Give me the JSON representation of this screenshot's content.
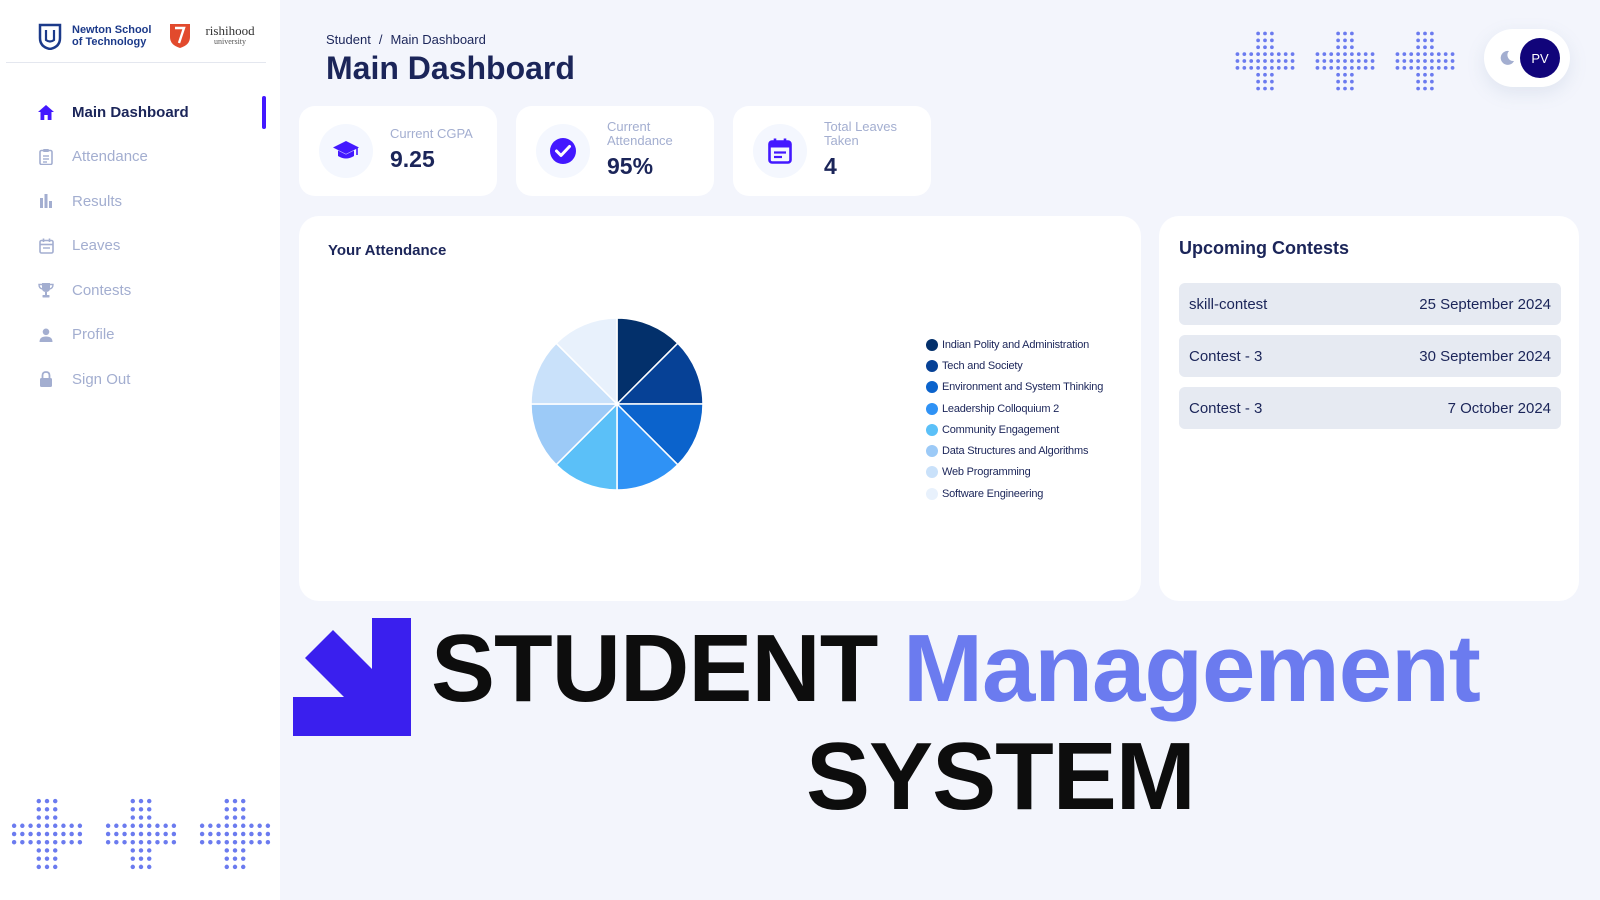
{
  "brand": {
    "school_line1": "Newton School",
    "school_line2": "of Technology",
    "university_name": "rishihood",
    "university_sub": "university"
  },
  "sidebar": {
    "items": [
      {
        "label": "Main Dashboard",
        "icon": "home-icon",
        "active": true
      },
      {
        "label": "Attendance",
        "icon": "clipboard-icon",
        "active": false
      },
      {
        "label": "Results",
        "icon": "bar-chart-icon",
        "active": false
      },
      {
        "label": "Leaves",
        "icon": "calendar-icon",
        "active": false
      },
      {
        "label": "Contests",
        "icon": "trophy-icon",
        "active": false
      },
      {
        "label": "Profile",
        "icon": "person-icon",
        "active": false
      },
      {
        "label": "Sign Out",
        "icon": "lock-icon",
        "active": false
      }
    ]
  },
  "header": {
    "breadcrumb_root": "Student",
    "breadcrumb_separator": "/",
    "breadcrumb_current": "Main Dashboard",
    "title": "Main Dashboard",
    "avatar_initials": "PV"
  },
  "stats": [
    {
      "label": "Current CGPA",
      "value": "9.25",
      "icon": "graduation-cap-icon"
    },
    {
      "label": "Current Attendance",
      "value": "95%",
      "icon": "check-circle-icon"
    },
    {
      "label": "Total Leaves Taken",
      "value": "4",
      "icon": "calendar-icon"
    }
  ],
  "attendance": {
    "title": "Your Attendance",
    "legend": [
      {
        "label": "Indian Polity and Administration",
        "color": "#03306b"
      },
      {
        "label": "Tech and Society",
        "color": "#064196"
      },
      {
        "label": "Environment and System Thinking",
        "color": "#0b63cc"
      },
      {
        "label": "Leadership Colloquium 2",
        "color": "#2f92f5"
      },
      {
        "label": "Community Engagement",
        "color": "#5bc0f8"
      },
      {
        "label": "Data Structures and Algorithms",
        "color": "#9ccaf7"
      },
      {
        "label": "Web Programming",
        "color": "#c9e1fa"
      },
      {
        "label": "Software Engineering",
        "color": "#e8f1fc"
      }
    ]
  },
  "contests": {
    "title": "Upcoming Contests",
    "items": [
      {
        "name": "skill-contest",
        "date": "25 September 2024"
      },
      {
        "name": "Contest - 3",
        "date": "30 September 2024"
      },
      {
        "name": "Contest - 3",
        "date": "7 October 2024"
      }
    ]
  },
  "banner": {
    "word1": "STUDENT",
    "word2": "Management",
    "word3": "SYSTEM"
  },
  "colors": {
    "accent": "#4318ff",
    "navy": "#1b2559",
    "muted": "#a3aed0",
    "banner_accent": "#6b7bef"
  }
}
